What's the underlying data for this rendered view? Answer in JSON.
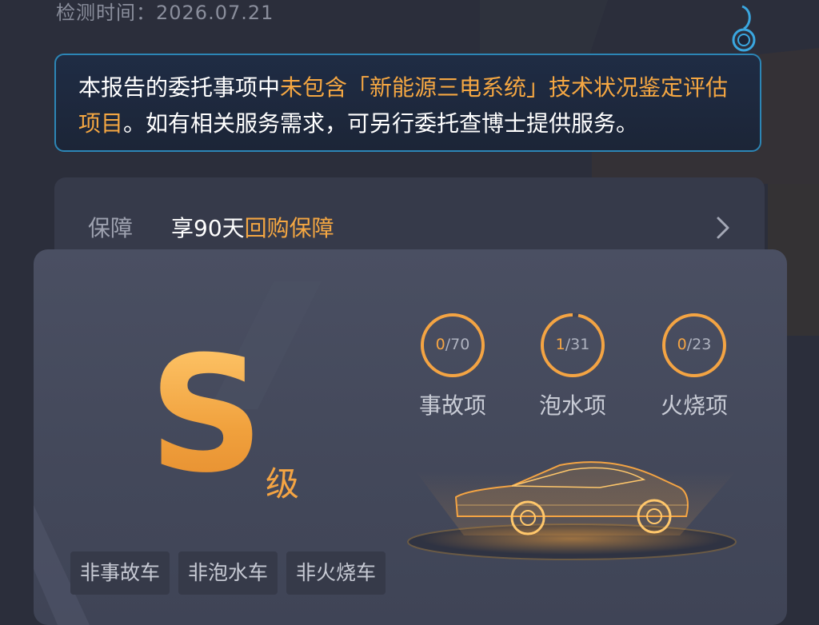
{
  "header": {
    "check_time_label": "检测时间：",
    "check_time_value": "2026.07.21"
  },
  "notice": {
    "seg1": "本报告的委托事项中",
    "seg2": "未包含「新能源三电系统」技术状况鉴定评估项目",
    "seg3": "。如有相关服务需求，可另行委托查博士提供服务。"
  },
  "guarantee": {
    "label": "保障",
    "text_prefix": "享90天",
    "text_highlight": "回购保障"
  },
  "grade": {
    "letter": "S",
    "suffix": "级"
  },
  "stats": [
    {
      "count": "0",
      "total": "/70",
      "label": "事故项",
      "progress": 0.0
    },
    {
      "count": "1",
      "total": "/31",
      "label": "泡水项",
      "progress": 0.032
    },
    {
      "count": "0",
      "total": "/23",
      "label": "火烧项",
      "progress": 0.0
    }
  ],
  "tags": [
    "非事故车",
    "非泡水车",
    "非火烧车"
  ],
  "colors": {
    "accent": "#f4a443",
    "notice_border": "#2c86b6",
    "background": "#2b2e3b",
    "card": "#474c5f"
  },
  "icons": {
    "chevron": "chevron-right-icon",
    "car": "car-hologram-icon",
    "clip": "clip-icon"
  }
}
